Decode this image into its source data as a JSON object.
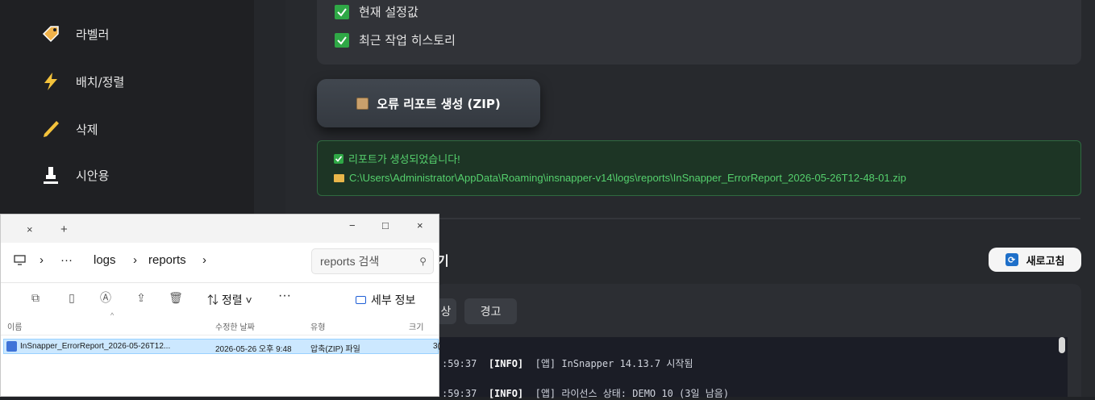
{
  "sidebar": {
    "items": [
      {
        "label": "라벨러",
        "icon": "tag-icon"
      },
      {
        "label": "배치/정렬",
        "icon": "lightning-icon"
      },
      {
        "label": "삭제",
        "icon": "pencil-icon"
      },
      {
        "label": "시안용",
        "icon": "stamp-icon"
      }
    ]
  },
  "main": {
    "checkboxes": [
      {
        "label": "현재 설정값",
        "checked": true
      },
      {
        "label": "최근 작업 히스토리",
        "checked": true
      }
    ],
    "generate_button": "오류 리포트 생성 (ZIP)",
    "success": {
      "message": "리포트가 생성되었습니다!",
      "path": "C:\\Users\\Administrator\\AppData\\Roaming\\insnapper-v14\\logs\\reports\\InSnapper_ErrorReport_2026-05-26T12-48-01.zip"
    },
    "viewer_title_fragment": "기",
    "refresh_button": "새로고침",
    "filters": [
      "상",
      "경고"
    ],
    "logs": [
      {
        "time": ":59:37",
        "level": "[INFO]",
        "text": "[앱] InSnapper 14.13.7 시작됨"
      },
      {
        "time": ":59:37",
        "level": "[INFO]",
        "text": "[앱] 라이선스 상태: DEMO 10 (3일 남음)"
      }
    ]
  },
  "explorer": {
    "tab_close": "×",
    "tab_add": "+",
    "window_controls": [
      "−",
      "□",
      "×"
    ],
    "breadcrumb": [
      "···",
      "logs",
      "reports"
    ],
    "search_placeholder": "reports 검색",
    "toolbar": {
      "sort": "정렬",
      "more": "···",
      "details": "세부 정보"
    },
    "columns": [
      "이름",
      "수정한 날짜",
      "유형",
      "크기"
    ],
    "files": [
      {
        "name": "InSnapper_ErrorReport_2026-05-26T12...",
        "modified": "2026-05-26 오후 9:48",
        "type": "압축(ZIP) 파일",
        "size": "3("
      }
    ]
  },
  "colors": {
    "success_green": "#55d06d",
    "checkbox_green": "#2fa846",
    "selection_blue": "#cce8ff"
  }
}
